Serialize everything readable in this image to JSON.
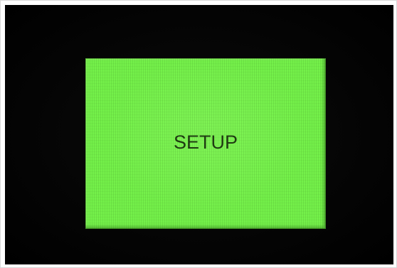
{
  "display": {
    "title": "SETUP",
    "background_color": "#74f04a",
    "bezel_color": "#000000",
    "text_color": "#1f3a12"
  }
}
